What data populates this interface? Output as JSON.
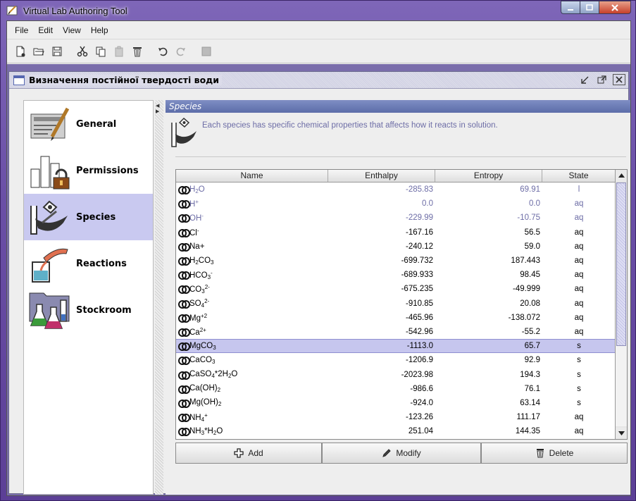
{
  "window": {
    "title": "Virtual Lab Authoring Tool"
  },
  "menu": [
    "File",
    "Edit",
    "View",
    "Help"
  ],
  "toolbar": [
    "new-icon",
    "open-icon",
    "save-icon",
    "cut-icon",
    "copy-icon",
    "paste-icon",
    "delete-icon",
    "undo-icon",
    "redo-icon",
    "stop-icon"
  ],
  "document": {
    "title": "Визначення постійної твердості води"
  },
  "sidebar": {
    "items": [
      {
        "label": "General"
      },
      {
        "label": "Permissions"
      },
      {
        "label": "Species",
        "selected": true
      },
      {
        "label": "Reactions"
      },
      {
        "label": "Stockroom"
      }
    ]
  },
  "panel": {
    "header": "Species",
    "info": "Each species has specific chemical properties that affects how it reacts in solution."
  },
  "table": {
    "columns": [
      "Name",
      "Enthalpy",
      "Entropy",
      "State"
    ],
    "rows": [
      {
        "name": "H<sub>2</sub>O",
        "enthalpy": "-285.83",
        "entropy": "69.91",
        "state": "l",
        "dim": true
      },
      {
        "name": "H<sup>+</sup>",
        "enthalpy": "0.0",
        "entropy": "0.0",
        "state": "aq",
        "dim": true
      },
      {
        "name": "OH<sup>-</sup>",
        "enthalpy": "-229.99",
        "entropy": "-10.75",
        "state": "aq",
        "dim": true
      },
      {
        "name": "Cl<sup>-</sup>",
        "enthalpy": "-167.16",
        "entropy": "56.5",
        "state": "aq"
      },
      {
        "name": "Na+",
        "enthalpy": "-240.12",
        "entropy": "59.0",
        "state": "aq"
      },
      {
        "name": "H<sub>2</sub>CO<sub>3</sub>",
        "enthalpy": "-699.732",
        "entropy": "187.443",
        "state": "aq"
      },
      {
        "name": "HCO<sub>3</sub><sup>-</sup>",
        "enthalpy": "-689.933",
        "entropy": "98.45",
        "state": "aq"
      },
      {
        "name": "CO<sub>3</sub><sup>2-</sup>",
        "enthalpy": "-675.235",
        "entropy": "-49.999",
        "state": "aq"
      },
      {
        "name": "SO<sub>4</sub><sup>2-</sup>",
        "enthalpy": "-910.85",
        "entropy": "20.08",
        "state": "aq"
      },
      {
        "name": "Mg<sup>+2</sup>",
        "enthalpy": "-465.96",
        "entropy": "-138.072",
        "state": "aq"
      },
      {
        "name": "Ca<sup>2+</sup>",
        "enthalpy": "-542.96",
        "entropy": "-55.2",
        "state": "aq"
      },
      {
        "name": "MgCO<sub>3</sub>",
        "enthalpy": "-1113.0",
        "entropy": "65.7",
        "state": "s",
        "selected": true
      },
      {
        "name": "CaCO<sub>3</sub>",
        "enthalpy": "-1206.9",
        "entropy": "92.9",
        "state": "s"
      },
      {
        "name": "CaSO<sub>4</sub>*2H<sub>2</sub>O",
        "enthalpy": "-2023.98",
        "entropy": "194.3",
        "state": "s"
      },
      {
        "name": "Ca(OH)<sub>2</sub>",
        "enthalpy": "-986.6",
        "entropy": "76.1",
        "state": "s"
      },
      {
        "name": "Mg(OH)<sub>2</sub>",
        "enthalpy": "-924.0",
        "entropy": "63.14",
        "state": "s"
      },
      {
        "name": "NH<sub>4</sub><sup>+</sup>",
        "enthalpy": "-123.26",
        "entropy": "111.17",
        "state": "aq"
      },
      {
        "name": "NH<sub>3</sub>*H<sub>2</sub>O",
        "enthalpy": "251.04",
        "entropy": "144.35",
        "state": "aq"
      }
    ]
  },
  "buttons": {
    "add": "Add",
    "modify": "Modify",
    "delete": "Delete"
  },
  "colors": {
    "title_gradient": "#6a4fa6",
    "selected_row": "#c6c6ee",
    "panel_header": "#5c6da9",
    "info_text": "#6d6da6"
  }
}
